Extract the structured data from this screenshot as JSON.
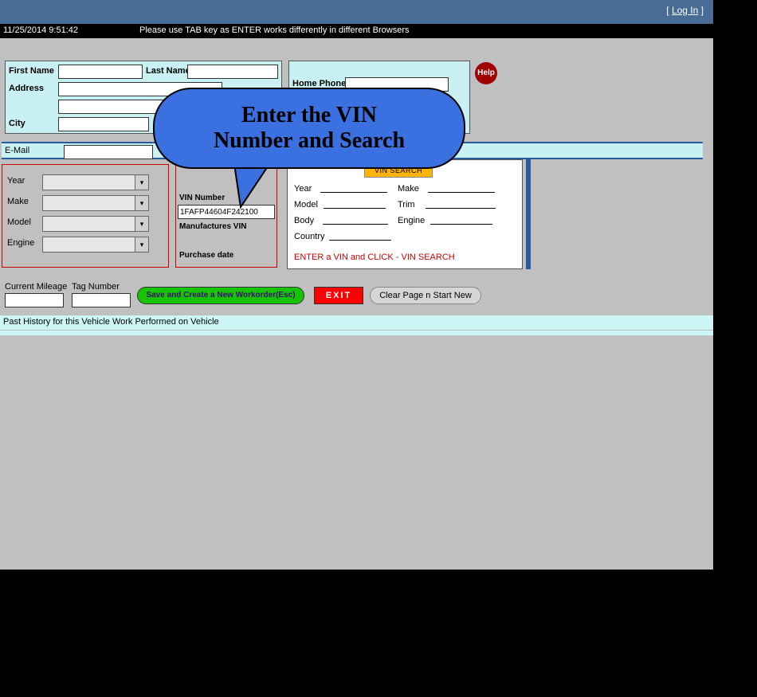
{
  "topbar": {
    "login_label": "Log In"
  },
  "statusbar": {
    "timestamp": "11/25/2014 9:51:42",
    "message": "Please use TAB key as ENTER works differently in different Browsers"
  },
  "customer": {
    "first_name_label": "First Name",
    "first_name_value": "",
    "last_name_label": "Last Name",
    "last_name_value": "",
    "address_label": "Address",
    "address1_value": "",
    "address2_value": "",
    "city_label": "City",
    "city_value": ""
  },
  "phone": {
    "home_phone_label": "Home Phone",
    "home_phone_value": ""
  },
  "help": {
    "label": "Help"
  },
  "email": {
    "label": "E-Mail",
    "value": ""
  },
  "vehicle": {
    "year_label": "Year",
    "year_value": "",
    "make_label": "Make",
    "make_value": "",
    "model_label": "Model",
    "model_value": "",
    "engine_label": "Engine",
    "engine_value": ""
  },
  "vin": {
    "vin_label": "VIN Number",
    "vin_value": "1FAFP44604F242100",
    "mfr_vin_label": "Manufactures VIN",
    "mfr_vin_value": "",
    "purchase_date_label": "Purchase date",
    "purchase_date_value": ""
  },
  "results": {
    "vin_search_btn": "VIN SEARCH",
    "year_label": "Year",
    "make_label": "Make",
    "model_label": "Model",
    "trim_label": "Trim",
    "body_label": "Body",
    "engine_label": "Engine",
    "country_label": "Country",
    "hint": "ENTER a VIN and CLICK - VIN SEARCH"
  },
  "bottom": {
    "current_mileage_label": "Current Mileage",
    "current_mileage_value": "",
    "tag_number_label": "Tag Number",
    "tag_number_value": "",
    "save_btn": "Save and Create a New Workorder(Esc)",
    "exit_btn": "EXIT",
    "clear_btn": "Clear Page n Start New"
  },
  "history": {
    "label": "Past History for this Vehicle  Work Performed on Vehicle"
  },
  "callout": {
    "line1": "Enter the VIN",
    "line2": "Number and Search"
  }
}
